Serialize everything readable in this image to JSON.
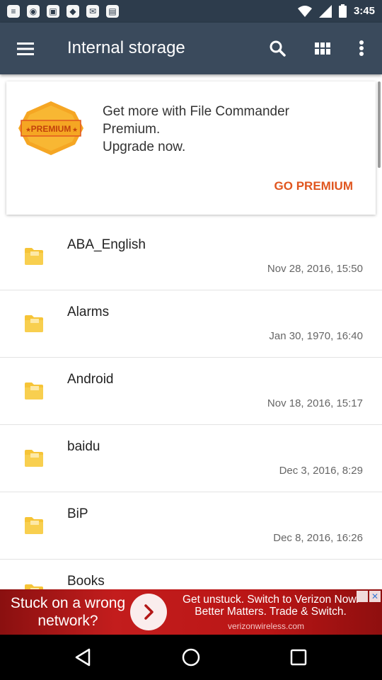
{
  "status_bar": {
    "time": "3:45",
    "left_icons": [
      "notification-icon",
      "notification-icon",
      "notification-icon",
      "notification-icon",
      "notification-icon",
      "notification-icon"
    ],
    "right_icons": [
      "wifi-icon",
      "signal-icon",
      "battery-icon"
    ]
  },
  "app_bar": {
    "title": "Internal storage",
    "actions": [
      "search-icon",
      "grid-view-icon",
      "more-options-icon"
    ]
  },
  "promo": {
    "badge_text": "PREMIUM",
    "message": "Get more with File Commander\nPremium.\nUpgrade now.",
    "button_label": "GO PREMIUM",
    "accent_color": "#e0561f"
  },
  "files": [
    {
      "name": "ABA_English",
      "date": "Nov 28, 2016, 15:50"
    },
    {
      "name": "Alarms",
      "date": "Jan 30, 1970, 16:40"
    },
    {
      "name": "Android",
      "date": "Nov 18, 2016, 15:17"
    },
    {
      "name": "baidu",
      "date": "Dec 3, 2016, 8:29"
    },
    {
      "name": "BiP",
      "date": "Dec 8, 2016, 16:26"
    },
    {
      "name": "Books",
      "date": ""
    }
  ],
  "ad": {
    "left_text": "Stuck on a wrong network?",
    "right_text": "Get unstuck. Switch to Verizon Now. Better Matters. Trade & Switch.",
    "url": "verizonwireless.com"
  },
  "colors": {
    "status_bar": "#2d3c4c",
    "app_bar": "#3a4a5c",
    "folder": "#f6c437",
    "ad_background": "#c31d1d"
  }
}
